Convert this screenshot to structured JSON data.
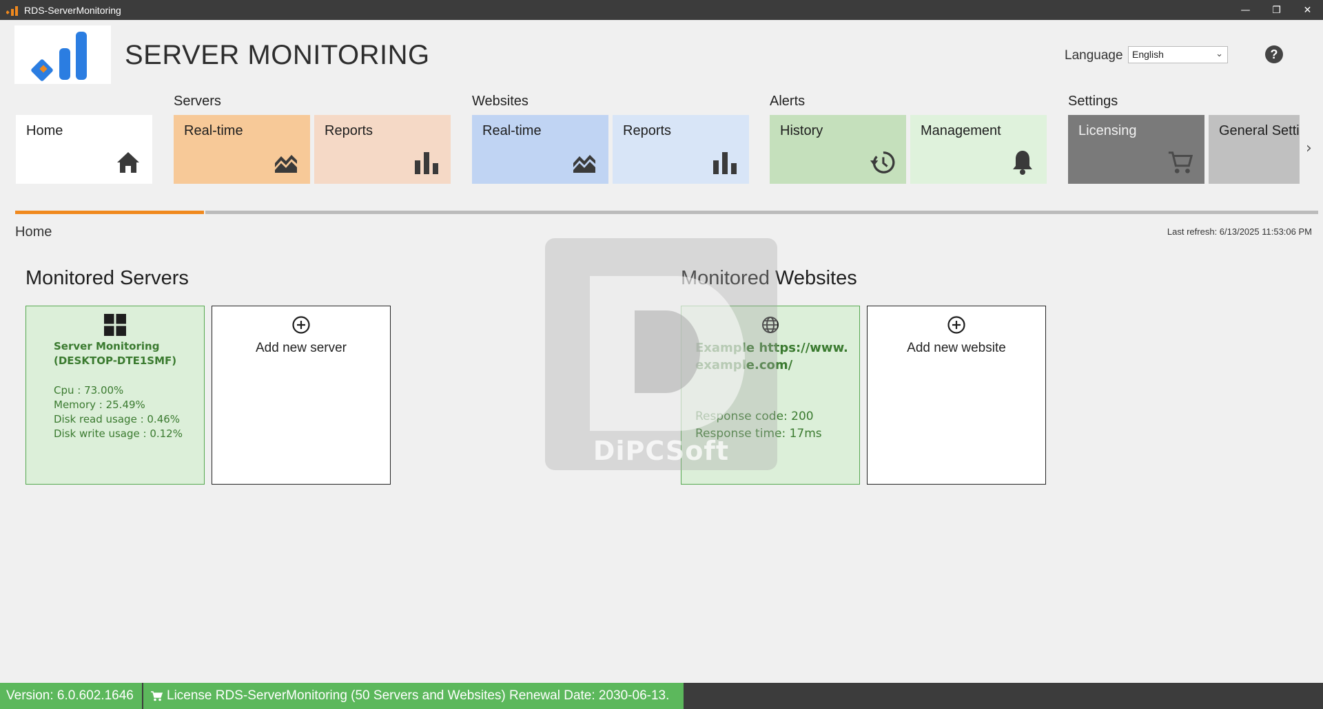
{
  "window": {
    "title": "RDS-ServerMonitoring",
    "minimize_label": "—",
    "restore_label": "❐",
    "close_label": "✕"
  },
  "header": {
    "app_title": "SERVER MONITORING",
    "language_label": "Language",
    "language_value": "English",
    "help_label": "?"
  },
  "nav": {
    "groups": [
      "Servers",
      "Websites",
      "Alerts",
      "Settings"
    ],
    "tiles": [
      {
        "label": "Home",
        "icon": "home-icon",
        "color": "#ffffff"
      },
      {
        "label": "Real-time",
        "icon": "realtime-chart-icon",
        "color": "#f7c998"
      },
      {
        "label": "Reports",
        "icon": "bar-chart-icon",
        "color": "#f5d9c6"
      },
      {
        "label": "Real-time",
        "icon": "realtime-chart-icon",
        "color": "#c0d4f3"
      },
      {
        "label": "Reports",
        "icon": "bar-chart-icon",
        "color": "#d8e5f7"
      },
      {
        "label": "History",
        "icon": "history-icon",
        "color": "#c5e0bc"
      },
      {
        "label": "Management",
        "icon": "bell-icon",
        "color": "#dff2dc"
      },
      {
        "label": "Licensing",
        "icon": "cart-icon",
        "color": "#7a7a7a"
      },
      {
        "label": "General Setti",
        "icon": "",
        "color": "#c0c0c0"
      }
    ],
    "next_label": "›",
    "accent": "#f0891e"
  },
  "breadcrumb": "Home",
  "last_refresh": "Last refresh: 6/13/2025 11:53:06 PM",
  "servers": {
    "title": "Monitored Servers",
    "server_name": "Server Monitoring (DESKTOP-DTE1SMF)",
    "metrics": [
      "Cpu : 73.00%",
      "Memory : 25.49%",
      "Disk read usage : 0.46%",
      "Disk write usage : 0.12%"
    ],
    "add_label": "Add new server"
  },
  "websites": {
    "title": "Monitored Websites",
    "site_name": "Example https://www.example.com/",
    "metrics": [
      "Response code: 200",
      "Response time: 17ms"
    ],
    "add_label": "Add new website"
  },
  "watermark": {
    "text": "DiPCSoft"
  },
  "status": {
    "version": "Version: 6.0.602.1646",
    "license": "License RDS-ServerMonitoring (50 Servers and Websites) Renewal Date: 2030-06-13."
  }
}
